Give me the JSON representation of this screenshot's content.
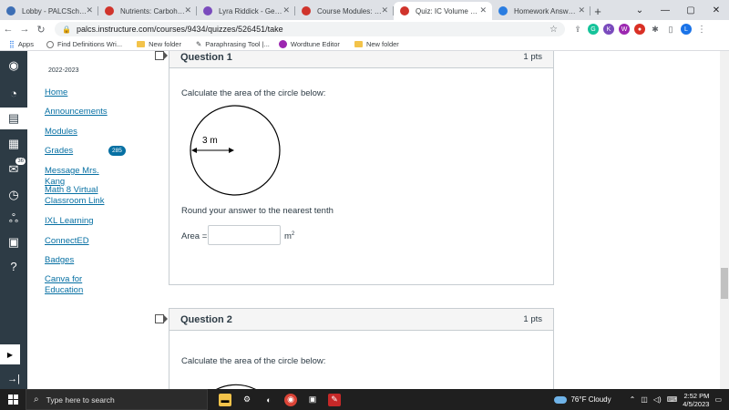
{
  "browser": {
    "tabs": [
      {
        "label": "Lobby - PALCSchool",
        "color": "#3d6fb5",
        "active": false
      },
      {
        "label": "Nutrients: Carbohydra",
        "color": "#d0342c",
        "active": false
      },
      {
        "label": "Lyra Riddick - Geometr",
        "color": "#7a4bbd",
        "active": false
      },
      {
        "label": "Course Modules: Mat",
        "color": "#d0342c",
        "active": false
      },
      {
        "label": "Quiz: IC Volume of Co",
        "color": "#d0342c",
        "active": true
      },
      {
        "label": "Homework Answers H",
        "color": "#2a7de1",
        "active": false
      }
    ],
    "new_tab": "+",
    "url": "palcs.instructure.com/courses/9434/quizzes/526451/take",
    "bookmarks": [
      {
        "label": "Apps",
        "type": "apps"
      },
      {
        "label": "Find Definitions Wri...",
        "type": "site"
      },
      {
        "label": "New folder",
        "type": "folder"
      },
      {
        "label": "Paraphrasing Tool |...",
        "type": "site"
      },
      {
        "label": "Wordtune Editor",
        "type": "site"
      },
      {
        "label": "New folder",
        "type": "folder"
      }
    ]
  },
  "global_nav": {
    "inbox_badge": "36"
  },
  "course_nav": {
    "term": "2022-2023",
    "items": [
      {
        "label": "Home"
      },
      {
        "label": "Announcements"
      },
      {
        "label": "Modules"
      },
      {
        "label": "Grades"
      },
      {
        "label": "Message Mrs. Kang"
      },
      {
        "label": "Math 8 Virtual Classroom Link"
      },
      {
        "label": "IXL Learning"
      },
      {
        "label": "ConnectED"
      },
      {
        "label": "Badges"
      },
      {
        "label": "Canva for Education"
      }
    ],
    "grades_badge": "285"
  },
  "questions": [
    {
      "title": "Question 1",
      "points": "1 pts",
      "prompt": "Calculate the area of the circle below:",
      "radius_label": "3 m",
      "instruction": "Round your answer to the nearest tenth",
      "answer_label": "Area =",
      "answer_value": "",
      "unit": "m",
      "unit_sup": "2"
    },
    {
      "title": "Question 2",
      "points": "1 pts",
      "prompt": "Calculate the area of the circle below:"
    }
  ],
  "taskbar": {
    "search_placeholder": "Type here to search",
    "weather": "76°F  Cloudy",
    "time": "2:52 PM",
    "date": "4/5/2023"
  }
}
